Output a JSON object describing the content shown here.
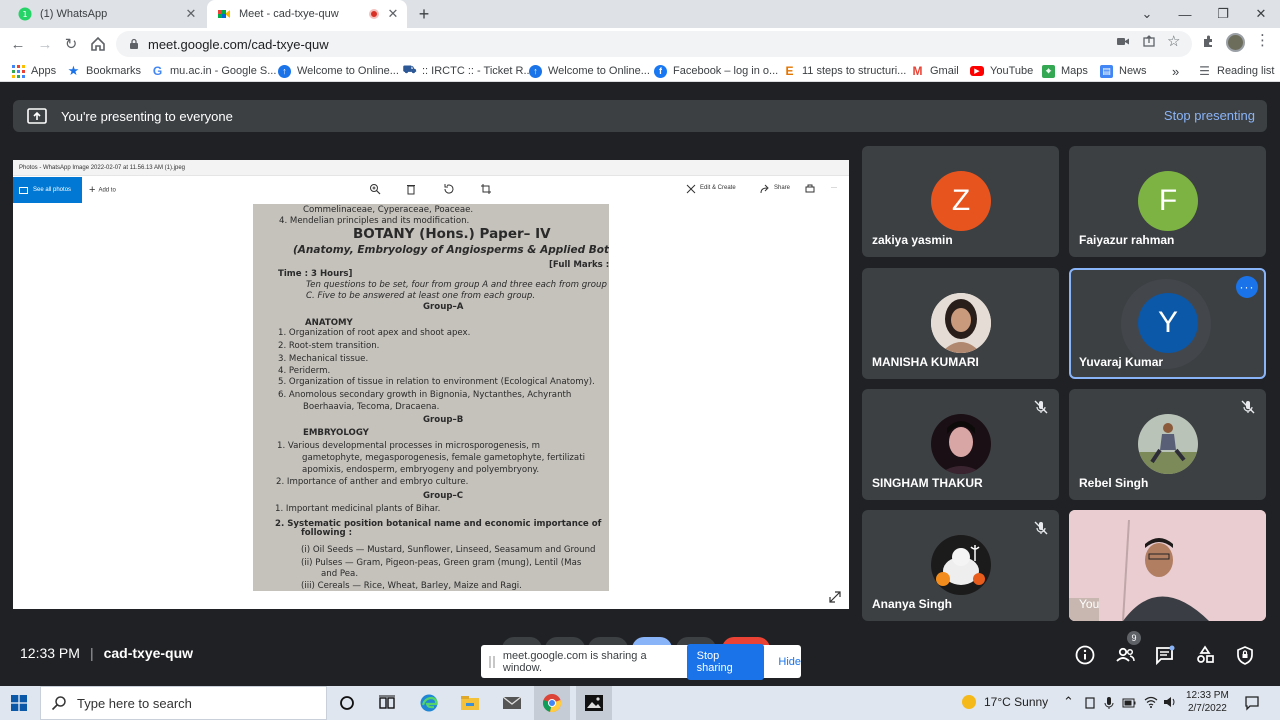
{
  "browser": {
    "tabs": [
      {
        "title": "(1) WhatsApp",
        "active": false
      },
      {
        "title": "Meet - cad-txye-quw",
        "active": true
      }
    ],
    "url": "meet.google.com/cad-txye-quw",
    "bookmarks": [
      {
        "label": "Apps",
        "icon": "apps-grid-icon"
      },
      {
        "label": "Bookmarks",
        "icon": "star-icon"
      },
      {
        "label": "mu.ac.in - Google S...",
        "icon": "google-icon"
      },
      {
        "label": "Welcome to Online...",
        "icon": "globe-icon"
      },
      {
        "label": ":: IRCTC :: - Ticket R...",
        "icon": "irctc-icon"
      },
      {
        "label": "Welcome to Online...",
        "icon": "globe-icon"
      },
      {
        "label": "Facebook – log in o...",
        "icon": "facebook-icon"
      },
      {
        "label": "11 steps to structuri...",
        "icon": "e-icon"
      },
      {
        "label": "Gmail",
        "icon": "gmail-icon"
      },
      {
        "label": "YouTube",
        "icon": "youtube-icon"
      },
      {
        "label": "Maps",
        "icon": "maps-icon"
      },
      {
        "label": "News",
        "icon": "news-icon"
      }
    ],
    "more_bookmarks": "»",
    "reading_list": "Reading list"
  },
  "meet": {
    "banner_text": "You're presenting to everyone",
    "stop_presenting": "Stop presenting",
    "time": "12:33 PM",
    "separator": "|",
    "meeting_code": "cad-txye-quw",
    "share_notice": "meet.google.com is sharing a window.",
    "stop_sharing": "Stop sharing",
    "hide": "Hide",
    "people_count": "9",
    "participants": [
      {
        "name": "zakiya yasmin",
        "letter": "Z",
        "color": "#e8541e",
        "muted": false
      },
      {
        "name": "Faiyazur rahman",
        "letter": "F",
        "color": "#7cb342",
        "muted": false
      },
      {
        "name": "MANISHA KUMARI",
        "letter": "",
        "muted": false
      },
      {
        "name": "Yuvaraj Kumar",
        "letter": "Y",
        "color": "#0b57a8",
        "muted": false
      },
      {
        "name": "SINGHAM THAKUR",
        "letter": "",
        "muted": true
      },
      {
        "name": "Rebel Singh",
        "letter": "",
        "muted": true
      },
      {
        "name": "Ananya Singh",
        "letter": "",
        "muted": true
      },
      {
        "name": "You",
        "letter": "",
        "muted": false
      }
    ]
  },
  "photos_app": {
    "window_title": "Photos - WhatsApp Image 2022-02-07 at 11.56.13 AM (1).jpeg",
    "see_all": "See all photos",
    "add_to": "Add to",
    "edit_create": "Edit & Create",
    "share": "Share",
    "more": "···"
  },
  "paper": {
    "lines": [
      "Commelinaceae, Cyperaceae, Poaceae.",
      "4.   Mendelian principles and its modification.",
      "BOTANY (Hons.) Paper– IV",
      "(Anatomy, Embryology of Angiosperms & Applied Botany)",
      "[Full Marks :",
      "Time : 3 Hours]",
      "Ten questions to be set, four from group A and three each from group B a",
      "C. Five to be answered at least one from each group.",
      "Group–A",
      "ANATOMY",
      "1.   Organization of root apex and shoot apex.",
      "2.   Root-stem transition.",
      "3.   Mechanical tissue.",
      "4.   Periderm.",
      "5.   Organization of tissue in relation to environment (Ecological Anatomy).",
      "6.   Anomolous secondary growth in Bignonia, Nyctanthes, Achyranth",
      "Boerhaavia, Tecoma, Dracaena.",
      "Group–B",
      "EMBRYOLOGY",
      "1.   Various developmental processes in microsporogenesis, m",
      "gametophyte, megasporogenesis, female gametophyte, fertilizati",
      "apomixis, endosperm, embryogeny and polyembryony.",
      "2.   Importance of anther and embryo culture.",
      "Group–C",
      "1.   Important medicinal plants of Bihar.",
      "2.   Systematic position botanical name and economic importance of",
      "following :",
      "(i)   Oil Seeds — Mustard, Sunflower, Linseed, Seasamum and Ground",
      "(ii)  Pulses — Gram, Pigeon-peas, Green gram (mung), Lentil (Mas",
      "and Pea.",
      "(iii) Cereals — Rice, Wheat, Barley, Maize and Ragi."
    ]
  },
  "taskbar": {
    "search_placeholder": "Type here to search",
    "weather": "17°C  Sunny",
    "time": "12:33 PM",
    "date": "2/7/2022"
  }
}
